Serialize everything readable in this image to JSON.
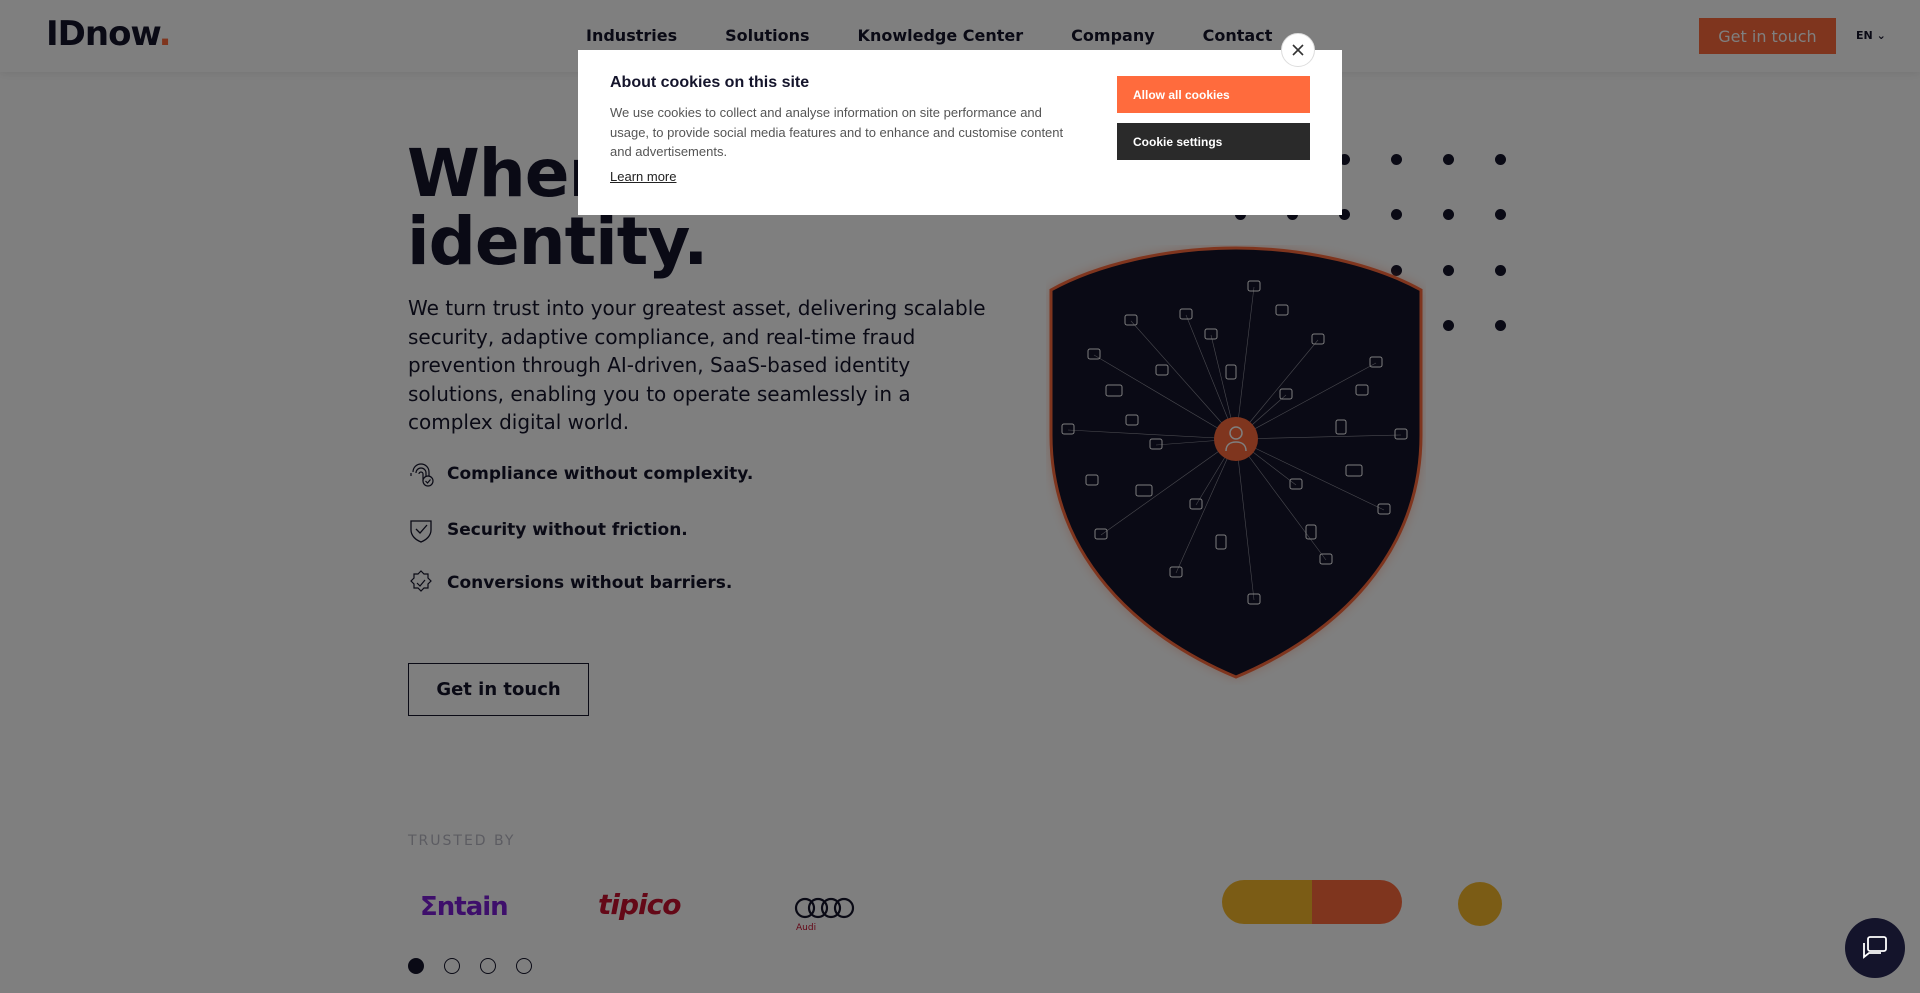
{
  "header": {
    "logo_text": "IDnow",
    "logo_dot": ".",
    "nav": [
      {
        "label": "Industries"
      },
      {
        "label": "Solutions"
      },
      {
        "label": "Knowledge Center"
      },
      {
        "label": "Company"
      },
      {
        "label": "Contact"
      }
    ],
    "cta_label": "Get in touch",
    "lang_label": "EN"
  },
  "hero": {
    "title_line1": "Where",
    "title_line2": "identity.",
    "description": "We turn trust into your greatest asset, delivering scalable security, adaptive compliance, and real-time fraud prevention through AI-driven, SaaS-based identity solutions, enabling you to operate seamlessly in a complex digital world.",
    "features": [
      {
        "icon": "fingerprint-icon",
        "label": "Compliance without complexity."
      },
      {
        "icon": "shield-check-icon",
        "label": "Security without friction."
      },
      {
        "icon": "badge-check-icon",
        "label": "Conversions without barriers."
      }
    ],
    "cta_label": "Get in touch"
  },
  "trusted": {
    "heading": "TRUSTED BY",
    "logos": [
      {
        "name": "Entain",
        "text": "Σntain"
      },
      {
        "name": "tipico",
        "text": "tipico"
      },
      {
        "name": "Audi",
        "text": "Audi"
      }
    ]
  },
  "cookie": {
    "title": "About cookies on this site",
    "text": "We use cookies to collect and analyse information on site performance and usage, to provide social media features and to enhance and customise content and advertisements.",
    "learn_more": "Learn more",
    "allow_label": "Allow all cookies",
    "settings_label": "Cookie settings"
  },
  "colors": {
    "accent": "#ff6b3d",
    "dark": "#14142b",
    "yellow": "#f6b92b"
  }
}
